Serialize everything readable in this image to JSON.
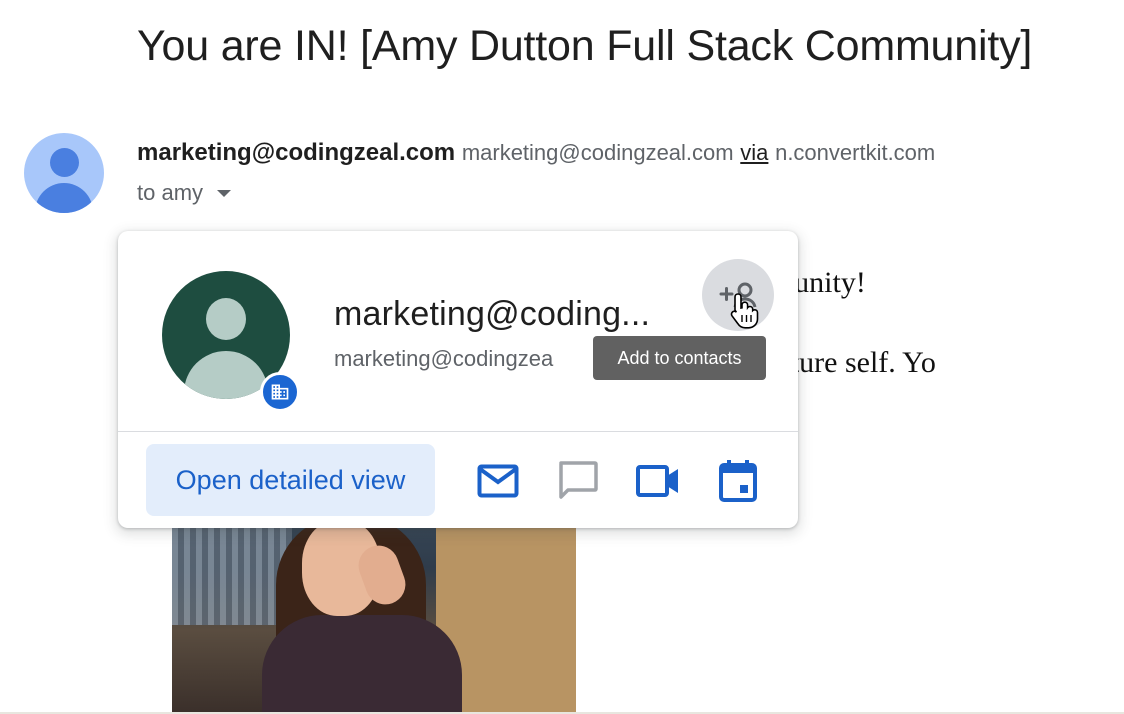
{
  "email": {
    "subject": "You are IN! [Amy Dutton Full Stack Community]",
    "from_name": "marketing@codingzeal.com",
    "from_email": "marketing@codingzeal.com",
    "via_label": "via",
    "via_domain": "n.convertkit.com",
    "to_label": "to amy",
    "body_line1": "dwood community!",
    "body_line2": "ES to your future self. Yo"
  },
  "contact_card": {
    "name": "marketing@coding...",
    "email": "marketing@codingzea",
    "tooltip": "Add to contacts",
    "open_detailed_view": "Open detailed view",
    "actions": [
      "mail-icon",
      "chat-icon",
      "video-call-icon",
      "calendar-icon"
    ]
  },
  "colors": {
    "accent_blue": "#1b61c9",
    "avatar_green": "#1e4d40",
    "sender_avatar_blue": "#a8c7fa",
    "tooltip_bg": "#616161"
  }
}
